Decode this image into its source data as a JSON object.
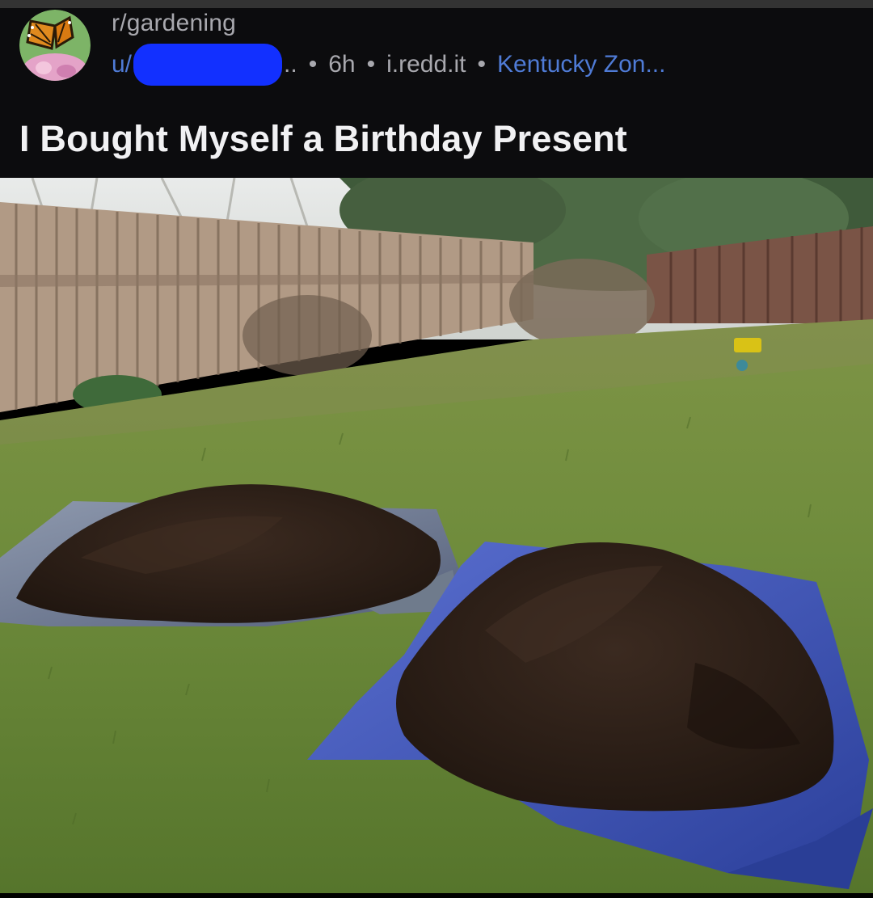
{
  "post": {
    "subreddit": "r/gardening",
    "user_prefix": "u/",
    "user_suffix": "..",
    "age": "6h",
    "domain": "i.redd.it",
    "flair": "Kentucky Zon...",
    "separator": "•",
    "title": "I Bought Myself a Birthday Present"
  },
  "icons": {
    "avatar": "butterfly-avatar-icon",
    "redaction": "username-redaction"
  },
  "colors": {
    "header_bg": "#0c0c0e",
    "link_blue": "#4f7bd6",
    "redaction_blue": "#1230ff",
    "title_text": "#f1f1f3",
    "meta_text": "#a8a8ae",
    "tarp_blue": "#3a52b8",
    "soil": "#2e2018",
    "grass": "#6f8c3c"
  }
}
